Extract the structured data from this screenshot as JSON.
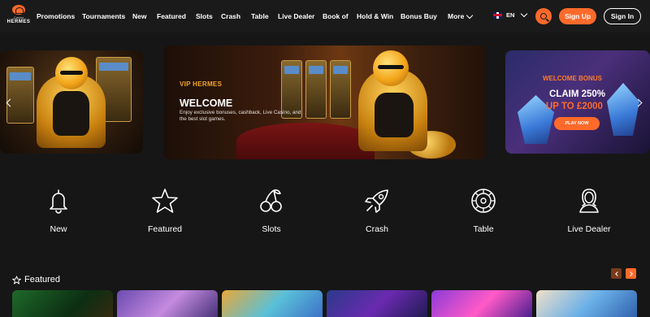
{
  "header": {
    "logo_sub": "Casino",
    "logo_main": "HERMES",
    "nav": [
      "Promotions",
      "Tournaments",
      "New",
      "Featured",
      "Slots",
      "Crash",
      "Table",
      "Live Dealer",
      "Book of",
      "Hold & Win",
      "Bonus Buy"
    ],
    "more_label": "More",
    "lang_label": "EN",
    "signup_label": "Sign Up",
    "signin_label": "Sign In"
  },
  "banners": {
    "center": {
      "tag": "VIP HERMES",
      "title": "WELCOME",
      "description": "Enjoy exclusive bonuses, cashback, Live Casino, and the best slot games."
    },
    "right": {
      "tag": "WELCOME BONUS",
      "claim": "CLAIM 250%",
      "amount": "UP TO £2000",
      "cta": "PLAY NOW"
    }
  },
  "categories": [
    {
      "label": "New",
      "icon": "bell-icon"
    },
    {
      "label": "Featured",
      "icon": "star-icon"
    },
    {
      "label": "Slots",
      "icon": "cherries-icon"
    },
    {
      "label": "Crash",
      "icon": "rocket-icon"
    },
    {
      "label": "Table",
      "icon": "roulette-icon"
    },
    {
      "label": "Live Dealer",
      "icon": "dealer-icon"
    }
  ],
  "featured": {
    "title": "Featured"
  },
  "colors": {
    "accent": "#ff6a2a",
    "background": "#161616",
    "nav_background": "#1a1a1a"
  }
}
